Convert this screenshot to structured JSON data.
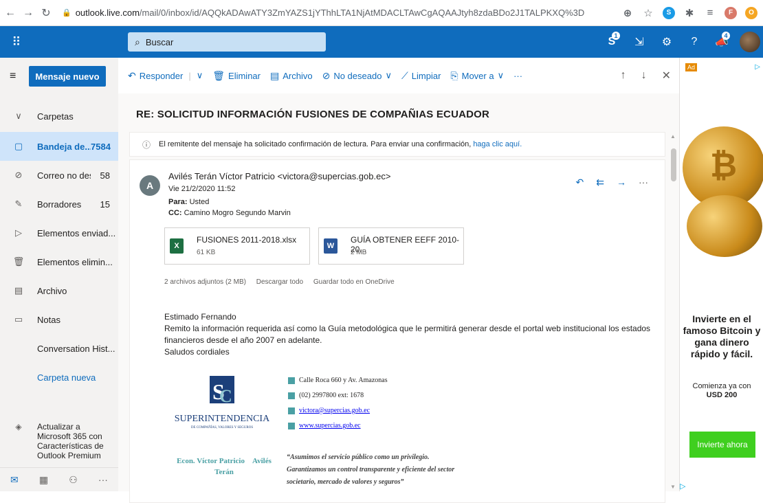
{
  "browser": {
    "url_host": "outlook.live.com",
    "url_path": "/mail/0/inbox/id/AQQkADAwATY3ZmYAZS1jYThhLTA1NjAtMDACLTAwCgAQAAJtyh8zdaBDo2J1TALPKXQ%3D",
    "ext_badge_letter": "F"
  },
  "header": {
    "search_placeholder": "Buscar",
    "skype_badge": "1",
    "feedback_badge": "4",
    "help_label": "?"
  },
  "leftnav": {
    "new_message": "Mensaje nuevo",
    "folders_header": "Carpetas",
    "folders": [
      {
        "label": "Bandeja de...",
        "count": "7584"
      },
      {
        "label": "Correo no des...",
        "count": "58"
      },
      {
        "label": "Borradores",
        "count": "15"
      },
      {
        "label": "Elementos enviad...",
        "count": ""
      },
      {
        "label": "Elementos elimin...",
        "count": ""
      },
      {
        "label": "Archivo",
        "count": ""
      },
      {
        "label": "Notas",
        "count": ""
      },
      {
        "label": "Conversation Hist...",
        "count": ""
      }
    ],
    "new_folder": "Carpeta nueva",
    "upgrade": "Actualizar a Microsoft 365 con Características de Outlook Premium"
  },
  "commands": {
    "reply": "Responder",
    "delete": "Eliminar",
    "archive": "Archivo",
    "junk": "No deseado",
    "sweep": "Limpiar",
    "move": "Mover a",
    "more": "···"
  },
  "message": {
    "subject": "RE: SOLICITUD INFORMACIÓN FUSIONES DE COMPAÑIAS ECUADOR",
    "receipt_text": "El remitente del mensaje ha solicitado confirmación de lectura. Para enviar una confirmación, ",
    "receipt_link": "haga clic aquí.",
    "sender_initial": "A",
    "sender": "Avilés Terán Víctor Patricio <victora@supercias.gob.ec>",
    "date": "Vie 21/2/2020 11:52",
    "to_label": "Para:",
    "to": "Usted",
    "cc_label": "CC:",
    "cc": "Camino Mogro Segundo Marvin",
    "attachments": [
      {
        "name": "FUSIONES 2011-2018.xlsx",
        "size": "61 KB",
        "type": "excel"
      },
      {
        "name": "GUÍA OBTENER EEFF 2010-20...",
        "size": "2 MB",
        "type": "word"
      }
    ],
    "attach_summary": "2 archivos adjuntos (2 MB)",
    "download_all": "Descargar todo",
    "save_onedrive": "Guardar todo en OneDrive",
    "body_greeting": "Estimado Fernando",
    "body_text": "Remito la información requerida así como la Guía metodológica que le permitirá generar desde el portal web institucional los estados financieros desde el año 2007 en adelante.",
    "body_closing": "Saludos cordiales",
    "sig_org_line1": "SUPERINTENDENCIA",
    "sig_org_line2": "DE COMPAÑÍAS, VALORES Y SEGUROS",
    "sig_address": "Calle Roca 660 y Av. Amazonas",
    "sig_phone": "(02) 2997800 ext: 1678",
    "sig_email": "victora@supercias.gob.ec",
    "sig_web": "www.supercias.gob.ec",
    "sig_name_1": "Econ. Víctor Patricio",
    "sig_name_2": "Avilés",
    "sig_name_3": "Terán",
    "sig_quote": "“Asumimos el servicio público como un privilegio. Garantizamos un control transparente y eficiente del sector societario, mercado de valores y seguros”"
  },
  "ad": {
    "badge": "Ad",
    "headline": "Invierte en el famoso Bitcoin y gana dinero rápido y fácil.",
    "sub": "Comienza ya con",
    "sub_bold": "USD 200",
    "cta": "Invierte ahora"
  },
  "colors": {
    "accent": "#0f6cbd",
    "selected_folder": "#cfe4fa",
    "ad_cta": "#3fcf1f"
  }
}
